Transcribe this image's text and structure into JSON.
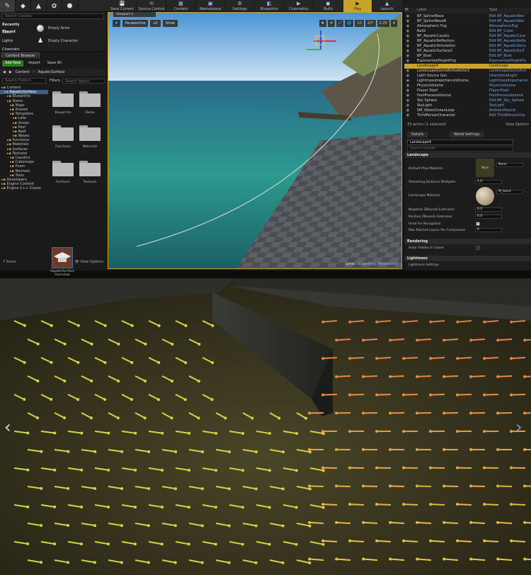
{
  "toolbar": {
    "modes": [
      "✎",
      "◆",
      "▲",
      "✿",
      "⬢"
    ],
    "buttons": [
      {
        "label": "Save Current",
        "icon": "💾"
      },
      {
        "label": "Source Control",
        "icon": "⟲"
      },
      {
        "label": "Content",
        "icon": "▦"
      },
      {
        "label": "Marketplace",
        "icon": "▣"
      },
      {
        "label": "Settings",
        "icon": "⚙"
      },
      {
        "label": "Blueprints",
        "icon": "◧"
      },
      {
        "label": "Cinematics",
        "icon": "▶"
      },
      {
        "label": "Build",
        "icon": "◼"
      },
      {
        "label": "Play",
        "icon": "▶"
      },
      {
        "label": "Launch",
        "icon": "▲"
      }
    ]
  },
  "place_actors": {
    "search_placeholder": "Search Classes",
    "categories": [
      "Recently Placed",
      "Basic",
      "Lights",
      "Cinematic"
    ],
    "items": [
      "Empty Actor",
      "Empty Character"
    ]
  },
  "content_browser": {
    "tab": "Content Browser",
    "add_new": "Add New",
    "import": "Import",
    "save_all": "Save All",
    "crumbs": [
      "Content",
      "AquaticSurface"
    ],
    "search_folders": "Search Folders",
    "filters": "Filters",
    "search_assets": "Search Aquati",
    "tree": [
      {
        "label": "Content",
        "depth": 0
      },
      {
        "label": "AquaticSurface",
        "depth": 1,
        "selected": true
      },
      {
        "label": "Blueprints",
        "depth": 2
      },
      {
        "label": "Demo",
        "depth": 2
      },
      {
        "label": "Maps",
        "depth": 3
      },
      {
        "label": "Shared",
        "depth": 3
      },
      {
        "label": "Templates",
        "depth": 3
      },
      {
        "label": "Lake",
        "depth": 4
      },
      {
        "label": "Ocean",
        "depth": 4
      },
      {
        "label": "Pool",
        "depth": 4
      },
      {
        "label": "Reef",
        "depth": 4
      },
      {
        "label": "Waves",
        "depth": 4
      },
      {
        "label": "Functions",
        "depth": 2
      },
      {
        "label": "Materials",
        "depth": 2
      },
      {
        "label": "Surfaces",
        "depth": 2
      },
      {
        "label": "Textures",
        "depth": 2
      },
      {
        "label": "Caustics",
        "depth": 3
      },
      {
        "label": "Cubemaps",
        "depth": 3
      },
      {
        "label": "Foam",
        "depth": 3
      },
      {
        "label": "Normals",
        "depth": 3
      },
      {
        "label": "Tools",
        "depth": 3
      },
      {
        "label": "Developers",
        "depth": 0
      },
      {
        "label": "Engine Content",
        "depth": 0
      },
      {
        "label": "Engine C++ Classe",
        "depth": 0
      }
    ],
    "folders": [
      "Blueprints",
      "Demo",
      "Functions",
      "Materials",
      "Surfaces",
      "Textures"
    ],
    "asset": "AquaticSurface Overview",
    "item_count": "7 items",
    "view_options": "View Options"
  },
  "viewport": {
    "tab": "Viewport 1",
    "perspective": "Perspective",
    "lit": "Lit",
    "show": "Show",
    "snap_values": [
      "10",
      "10°",
      "0.25",
      "4"
    ],
    "level_prefix": "Level:",
    "level_name": "OceanMap (Persistent)"
  },
  "outliner": {
    "col_label": "Label",
    "col_type": "Type",
    "rows": [
      {
        "label": "BP_SplineWave",
        "type": "Edit BP_AquaticWav"
      },
      {
        "label": "BP_SplineWave8",
        "type": "Edit BP_AquaticWav"
      },
      {
        "label": "Atmospheric Fog",
        "type": "AtmosphericFog"
      },
      {
        "label": "Ball2",
        "type": "Edit BP_Crate"
      },
      {
        "label": "BP_AquaticCaustic",
        "type": "Edit BP_AquaticCaus"
      },
      {
        "label": "BP_AquaticReflection",
        "type": "Edit BP_AquaticRefle"
      },
      {
        "label": "BP_AquaticSimulation",
        "type": "Edit BP_AquaticSimu"
      },
      {
        "label": "BP_AquaticSurface2",
        "type": "Edit BP_AquaticSurf"
      },
      {
        "label": "BP_Boat",
        "type": "Edit BP_Boat"
      },
      {
        "label": "ExponentialHeightFog",
        "type": "ExponentialHeightFo"
      },
      {
        "label": "Landscape4",
        "type": "Landscape",
        "selected": true
      },
      {
        "label": "LandscapeGizmoActiveActor1",
        "type": "LandscapeGizmoActi"
      },
      {
        "label": "Light Source Sun",
        "type": "DirectionalLight"
      },
      {
        "label": "LightmassImportanceVolume",
        "type": "LightmassImportance"
      },
      {
        "label": "PhysicsVolume",
        "type": "PhysicsVolume"
      },
      {
        "label": "Player Start",
        "type": "PlayerStart"
      },
      {
        "label": "PostProcessVolume",
        "type": "PostProcessVolume"
      },
      {
        "label": "Sky Sphere",
        "type": "Edit BP_Sky_Sphere"
      },
      {
        "label": "SkyLight",
        "type": "SkyLight"
      },
      {
        "label": "SM_WaterOceanLoop",
        "type": "AmbientSound"
      },
      {
        "label": "ThirdPersonCharacter",
        "type": "Edit ThirdPersonCha"
      }
    ],
    "footer": "33 actors (1 selected)",
    "view_options": "View Options"
  },
  "details": {
    "tab_details": "Details",
    "tab_world": "World Settings",
    "name": "Landscape4",
    "search_placeholder": "Search Details",
    "section_landscape": "Landscape",
    "prop_phys": "Default Phys Material",
    "phys_value": "None",
    "phys_thumb": "None",
    "prop_stream": "Streaming Distance Multiplier",
    "stream_value": "1.0",
    "prop_mat": "Landscape Material",
    "mat_value": "M_Sand",
    "prop_negz": "Negative ZBounds Extension",
    "negz_value": "0.0",
    "prop_posz": "Positive ZBounds Extension",
    "posz_value": "0.0",
    "prop_nav": "Used For Navigation",
    "prop_layers": "Max Painted Layers Per Component",
    "layers_value": "0",
    "section_rendering": "Rendering",
    "prop_hidden": "Actor Hidden In Game",
    "section_lightmass": "Lightmass",
    "prop_lightmass": "Lightmass Settings"
  },
  "colors": {
    "accent": "#c9a227",
    "selection": "#3a5f8a",
    "link": "#7aa5e0"
  }
}
